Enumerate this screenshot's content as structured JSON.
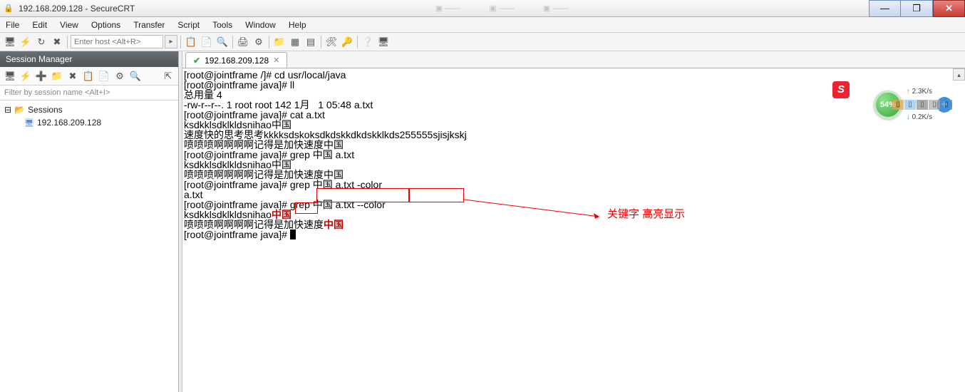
{
  "window": {
    "title": "192.168.209.128 - SecureCRT"
  },
  "menubar": {
    "items": [
      "File",
      "Edit",
      "View",
      "Options",
      "Transfer",
      "Script",
      "Tools",
      "Window",
      "Help"
    ]
  },
  "toolbar": {
    "host_placeholder": "Enter host <Alt+R>"
  },
  "session_manager": {
    "title": "Session Manager",
    "filter_placeholder": "Filter by session name <Alt+I>",
    "root": "Sessions",
    "sessions": [
      "192.168.209.128"
    ]
  },
  "tab": {
    "label": "192.168.209.128"
  },
  "terminal": {
    "lines": [
      {
        "t": "[root@jointframe /]# cd usr/local/java"
      },
      {
        "t": "[root@jointframe java]# ll"
      },
      {
        "t": "总用量 4"
      },
      {
        "t": "-rw-r--r--. 1 root root 142 1月   1 05:48 a.txt"
      },
      {
        "t": "[root@jointframe java]# cat a.txt"
      },
      {
        "t": "ksdkklsdklkldsnihao中国"
      },
      {
        "t": "速度快的思考思考kkkksdskoksdkdskkdkdskklkds255555sjisjkskj"
      },
      {
        "t": "喷喷喷啊啊啊啊记得是加快速度中国"
      },
      {
        "t": "[root@jointframe java]# grep 中国 a.txt"
      },
      {
        "t": "ksdkklsdklkldsnihao中国"
      },
      {
        "t": "喷喷喷啊啊啊啊记得是加快速度中国"
      },
      {
        "t": "[root@jointframe java]# grep 中国 a.txt -color"
      },
      {
        "t": "a.txt"
      },
      {
        "prompt": "[root@jointframe java]# ",
        "cmd_a": "grep 中国 a.txt ",
        "cmd_b": "--color"
      },
      {
        "pre": "ksdkklsdklkldsnihao",
        "hl": "中国"
      },
      {
        "pre": "喷喷喷啊啊啊啊记得是加快速度",
        "hl": "中国"
      },
      {
        "prompt_only": "[root@jointframe java]# "
      }
    ]
  },
  "annotation": {
    "text": "关键字 高亮显示"
  },
  "netwidget": {
    "percent": "54%",
    "up": "2.3K/s",
    "down": "0.2K/s"
  },
  "sicon": {
    "label": "S"
  }
}
